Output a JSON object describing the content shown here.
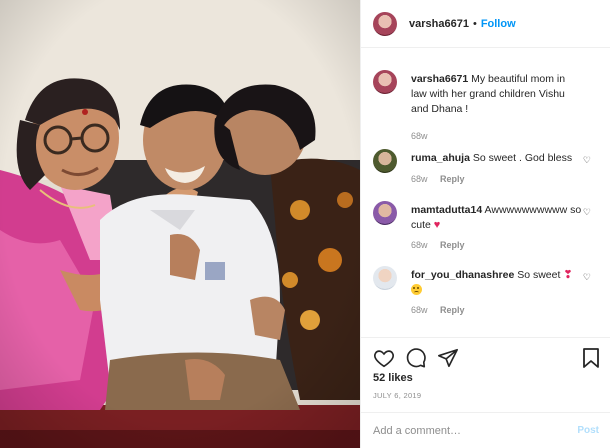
{
  "photo": {
    "alt_icon": "family-photo",
    "description_icon": "photo-grandmother-feeding-grandson-with-brother-kissing-cheek"
  },
  "header": {
    "username": "varsha6671",
    "separator": "•",
    "follow_label": "Follow",
    "more_icon": "more-horizontal-icon"
  },
  "caption": {
    "username": "varsha6671",
    "text": "My beautiful mom in law with her grand children Vishu and Dhana !",
    "age": "68w"
  },
  "comments": [
    {
      "username": "ruma_ahuja",
      "text": "So sweet . God bless",
      "age": "68w",
      "reply_label": "Reply"
    },
    {
      "username": "mamtadutta14",
      "text": "Awwwwwwwwww so cute",
      "emoji": "red-heart",
      "age": "68w",
      "reply_label": "Reply"
    },
    {
      "username": "for_you_dhanashree",
      "text": "So sweet",
      "emoji": "heart-exclamation",
      "emoji2": "pleading-face",
      "age": "68w",
      "reply_label": "Reply"
    }
  ],
  "actions": {
    "likes": "52 likes",
    "date": "JULY 6, 2019",
    "comment_placeholder": "Add a comment…",
    "post_label": "Post"
  },
  "colors": {
    "follow_blue": "#0095f6",
    "post_disabled": "#b2dffc",
    "meta_gray": "#8e8e8e",
    "text": "#262626",
    "heart_red": "#e0245e"
  }
}
